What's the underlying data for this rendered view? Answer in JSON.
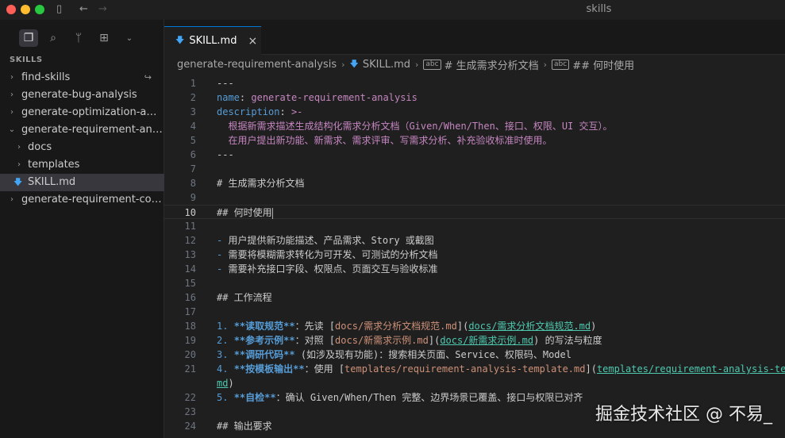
{
  "window": {
    "title": "skills"
  },
  "sidebar": {
    "section_title": "SKILLS",
    "items": [
      {
        "label": "find-skills",
        "type": "folder",
        "depth": 0,
        "expanded": false
      },
      {
        "label": "generate-bug-analysis",
        "type": "folder",
        "depth": 0,
        "expanded": false
      },
      {
        "label": "generate-optimization-anal...",
        "type": "folder",
        "depth": 0,
        "expanded": false
      },
      {
        "label": "generate-requirement-anal...",
        "type": "folder",
        "depth": 0,
        "expanded": true
      },
      {
        "label": "docs",
        "type": "folder",
        "depth": 1,
        "expanded": false
      },
      {
        "label": "templates",
        "type": "folder",
        "depth": 1,
        "expanded": false
      },
      {
        "label": "SKILL.md",
        "type": "file",
        "depth": 1,
        "selected": true
      },
      {
        "label": "generate-requirement-codi...",
        "type": "folder",
        "depth": 0,
        "expanded": false
      }
    ]
  },
  "tabs": [
    {
      "label": "SKILL.md",
      "active": true,
      "close": "×"
    }
  ],
  "breadcrumb": {
    "folder": "generate-requirement-analysis",
    "file": "SKILL.md",
    "symbol1": "# 生成需求分析文档",
    "symbol2": "## 何时使用",
    "symbol_icon": "abc"
  },
  "editor": {
    "current_line": 10,
    "lines": [
      {
        "n": "1",
        "t": "---"
      },
      {
        "n": "2",
        "t": "name: generate-requirement-analysis"
      },
      {
        "n": "3",
        "t": "description: >-"
      },
      {
        "n": "4",
        "t": "  根据新需求描述生成结构化需求分析文档（Given/When/Then、接口、权限、UI 交互）。"
      },
      {
        "n": "5",
        "t": "  在用户提出新功能、新需求、需求评审、写需求分析、补充验收标准时使用。"
      },
      {
        "n": "6",
        "t": "---"
      },
      {
        "n": "7",
        "t": ""
      },
      {
        "n": "8",
        "t": "# 生成需求分析文档"
      },
      {
        "n": "9",
        "t": ""
      },
      {
        "n": "10",
        "t": "## 何时使用"
      },
      {
        "n": "11",
        "t": ""
      },
      {
        "n": "12",
        "t": "- 用户提供新功能描述、产品需求、Story 或截图"
      },
      {
        "n": "13",
        "t": "- 需要将模糊需求转化为可开发、可测试的分析文档"
      },
      {
        "n": "14",
        "t": "- 需要补充接口字段、权限点、页面交互与验收标准"
      },
      {
        "n": "15",
        "t": ""
      },
      {
        "n": "16",
        "t": "## 工作流程"
      },
      {
        "n": "17",
        "t": ""
      },
      {
        "n": "18",
        "t": "1. **读取规范**：先读 [docs/需求分析文档规范.md](docs/需求分析文档规范.md)"
      },
      {
        "n": "19",
        "t": "2. **参考示例**：对照 [docs/新需求示例.md](docs/新需求示例.md) 的写法与粒度"
      },
      {
        "n": "20",
        "t": "3. **调研代码** (如涉及现有功能)：搜索相关页面、Service、权限码、Model"
      },
      {
        "n": "21",
        "t": "4. **按模板输出**：使用 [templates/requirement-analysis-template.md](templates/requirement-analysis-te"
      },
      {
        "n": "",
        "t": "md)"
      },
      {
        "n": "22",
        "t": "5. **自检**：确认 Given/When/Then 完整、边界场景已覆盖、接口与权限已对齐"
      },
      {
        "n": "23",
        "t": ""
      },
      {
        "n": "24",
        "t": "## 输出要求"
      }
    ]
  },
  "watermark": "掘金技术社区 @ 不易_",
  "colors": {
    "accent": "#0078d4",
    "editor_bg": "#1f1f1f",
    "sidebar_bg": "#181818",
    "key": "#569cd6",
    "string": "#ce9178",
    "yaml_block": "#c586c0"
  }
}
